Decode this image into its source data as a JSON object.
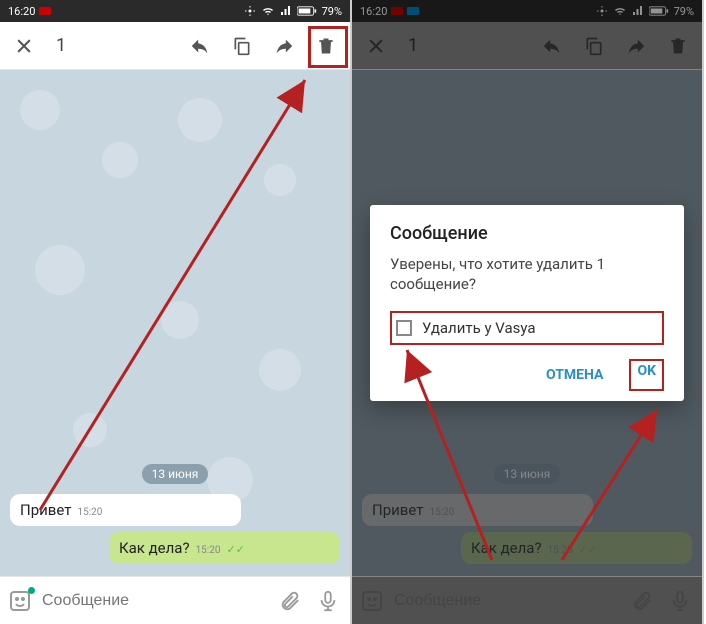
{
  "status": {
    "time": "16:20",
    "battery": "79%"
  },
  "toolbar": {
    "count": "1"
  },
  "chat": {
    "date": "13 июня",
    "msg_in": {
      "text": "Привет",
      "time": "15:20"
    },
    "msg_out": {
      "text": "Как дела?",
      "time": "15:20"
    }
  },
  "input": {
    "placeholder": "Сообщение"
  },
  "dialog": {
    "title": "Сообщение",
    "text": "Уверены, что хотите удалить 1 сообщение?",
    "checkbox": "Удалить у Vasya",
    "cancel": "ОТМЕНА",
    "ok": "OK"
  }
}
